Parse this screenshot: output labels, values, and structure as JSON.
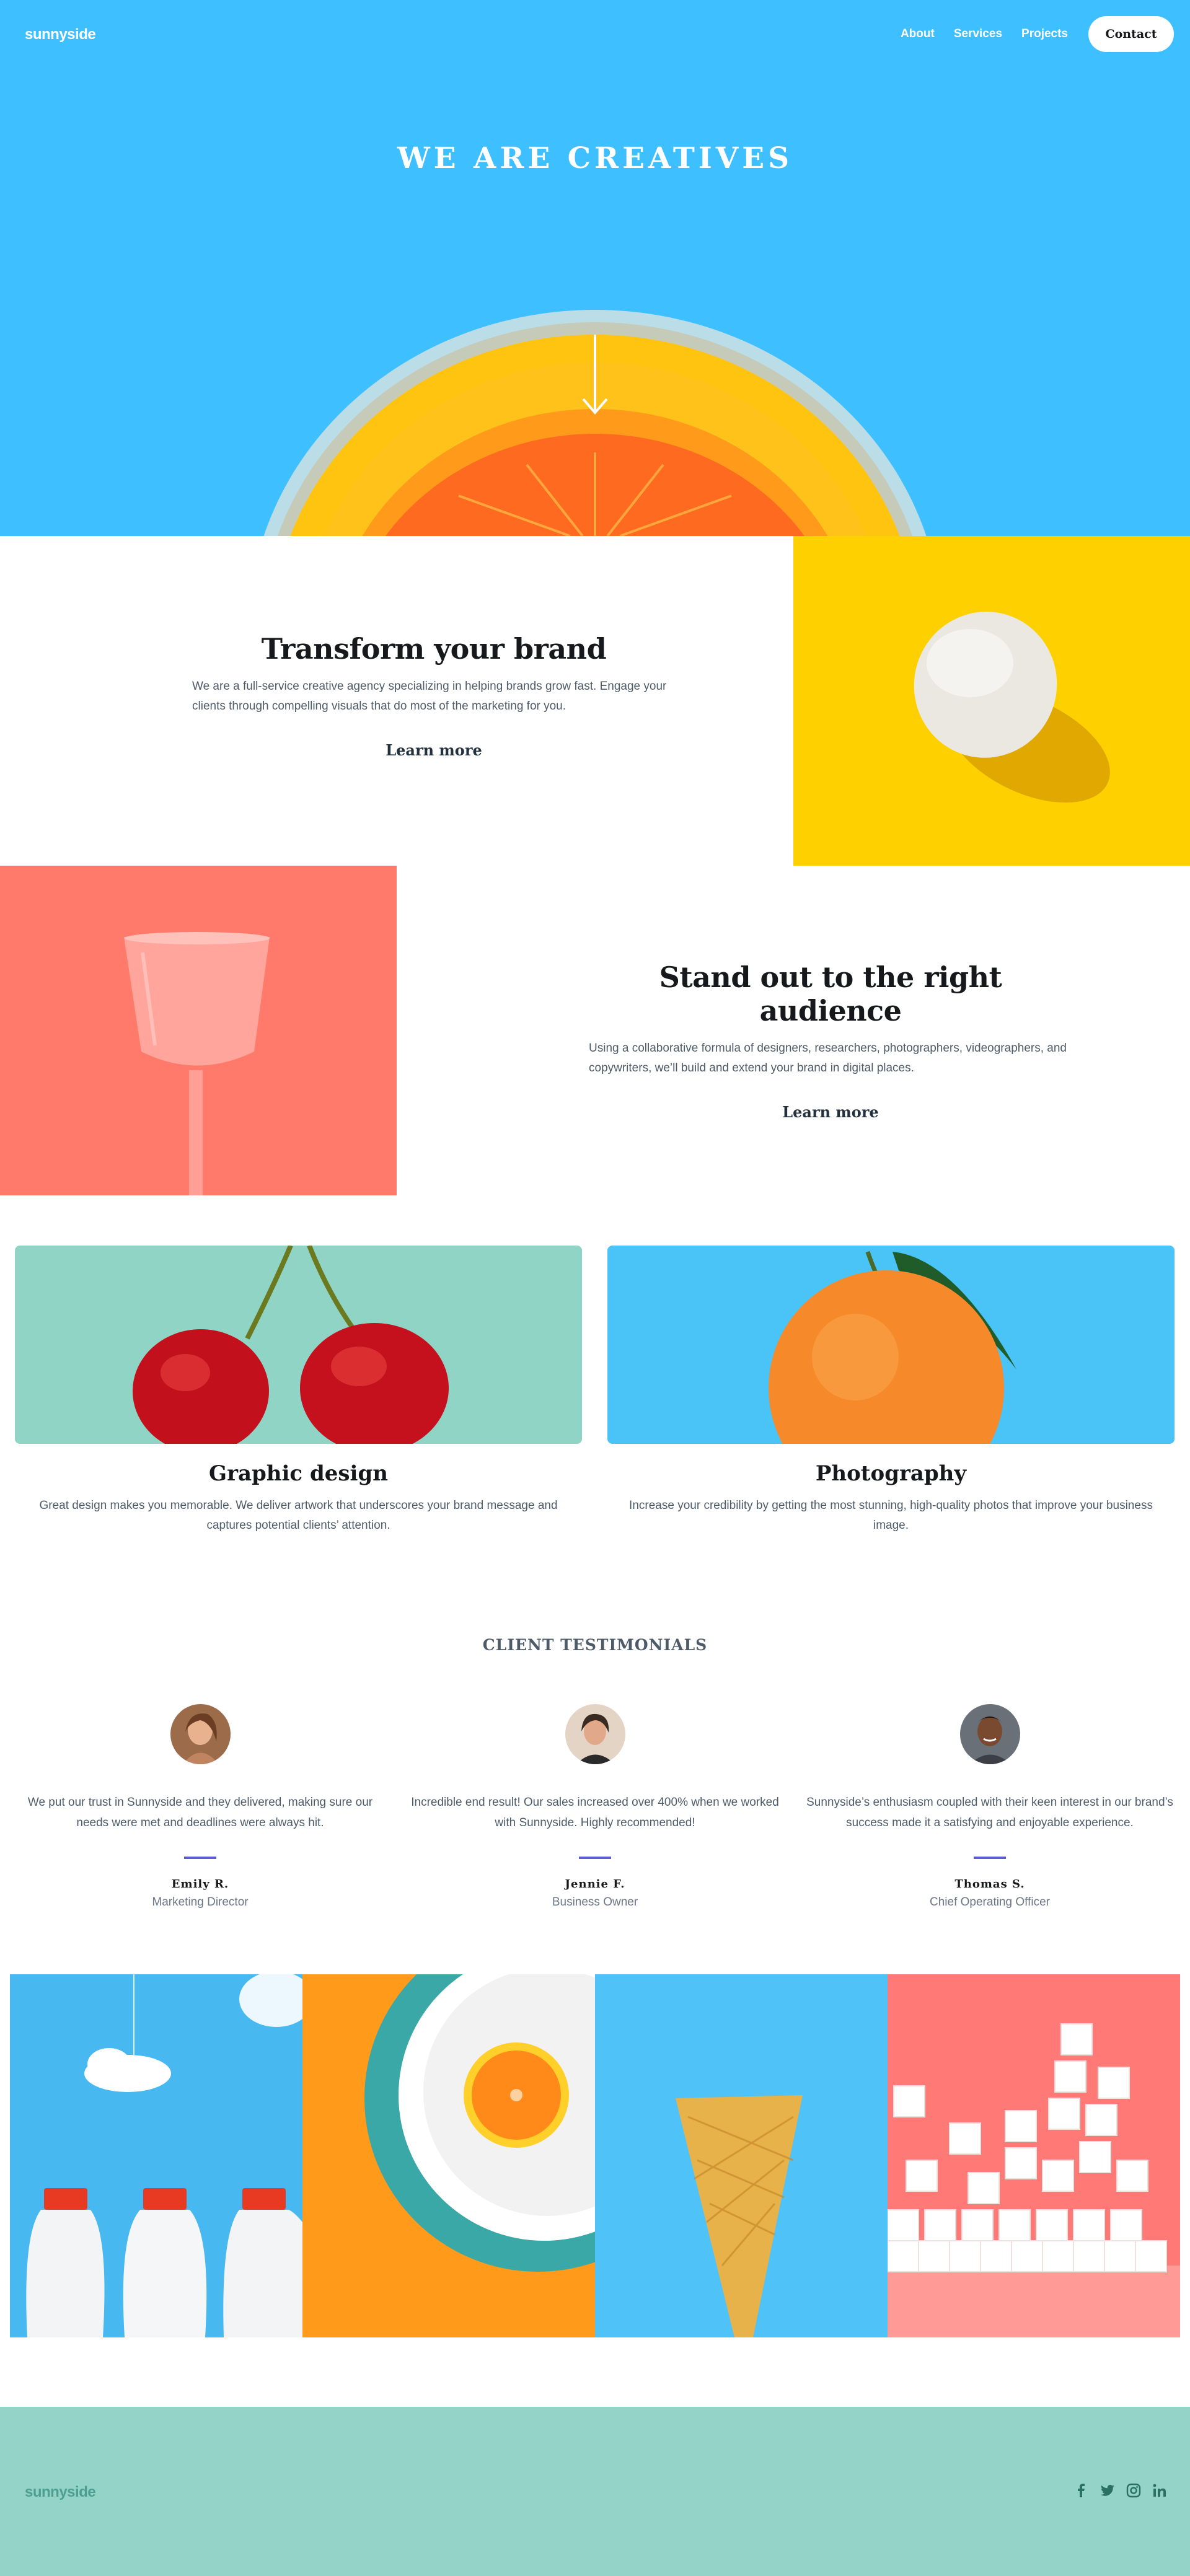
{
  "header": {
    "logo": "sunnyside",
    "nav": [
      {
        "label": "About"
      },
      {
        "label": "Services"
      },
      {
        "label": "Projects"
      }
    ],
    "contact_label": "Contact"
  },
  "hero": {
    "title": "WE ARE CREATIVES",
    "arrow_icon": "arrow-down-icon"
  },
  "sections": [
    {
      "title": "Transform your brand",
      "text": "We are a full-service creative agency specializing in helping brands grow fast. Engage your clients through compelling visuals that do most of the marketing for you.",
      "link": "Learn more"
    },
    {
      "title": "Stand out to the right audience",
      "text": "Using a collaborative formula of designers, researchers, photographers, videographers, and copywriters, we’ll build and extend your brand in digital places.",
      "link": "Learn more"
    }
  ],
  "services": [
    {
      "title": "Graphic design",
      "text": "Great design makes you memorable. We deliver artwork that underscores your brand message and captures potential clients’ attention."
    },
    {
      "title": "Photography",
      "text": "Increase your credibility by getting the most stunning, high-quality photos that improve your business image."
    }
  ],
  "testimonials": {
    "heading": "CLIENT TESTIMONIALS",
    "items": [
      {
        "quote": "We put our trust in Sunnyside and they delivered, making sure our needs were met and deadlines were always hit.",
        "name": "Emily R.",
        "role": "Marketing Director"
      },
      {
        "quote": "Incredible end result! Our sales increased over 400% when we worked with Sunnyside. Highly recommended!",
        "name": "Jennie F.",
        "role": "Business Owner"
      },
      {
        "quote": "Sunnyside’s enthusiasm coupled with their keen interest in our brand’s success made it a satisfying and enjoyable experience.",
        "name": "Thomas S.",
        "role": "Chief Operating Officer"
      }
    ]
  },
  "footer": {
    "logo": "sunnyside",
    "social_icons": [
      "facebook-icon",
      "twitter-icon",
      "instagram-icon",
      "linkedin-icon"
    ]
  },
  "colors": {
    "hero_blue": "#3ebfff",
    "yellow": "#fed000",
    "coral": "#ff6f61",
    "teal": "#94d3c8",
    "divider": "#5c5cd4"
  }
}
